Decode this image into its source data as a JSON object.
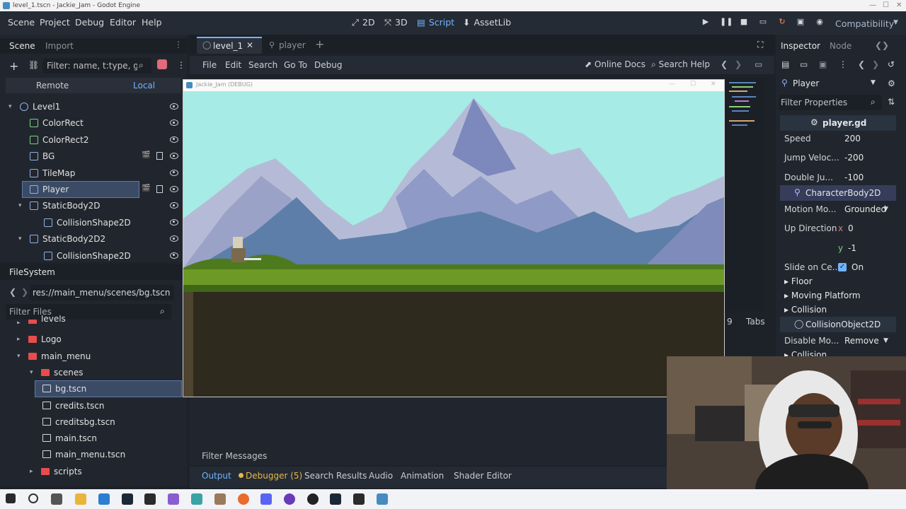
{
  "window": {
    "title": "level_1.tscn - Jackie_Jam - Godot Engine",
    "controls": [
      "—",
      "☐",
      "✕"
    ]
  },
  "menu": {
    "items": [
      "Scene",
      "Project",
      "Debug",
      "Editor",
      "Help"
    ]
  },
  "workspaces": [
    {
      "label": "2D",
      "icon": "2d-icon"
    },
    {
      "label": "3D",
      "icon": "3d-icon"
    },
    {
      "label": "Script",
      "icon": "script-icon"
    },
    {
      "label": "AssetLib",
      "icon": "assetlib-icon"
    }
  ],
  "renderer": "Compatibility",
  "scene_panel": {
    "tab_scene": "Scene",
    "tab_import": "Import",
    "filter_placeholder": "Filter: name, t:type, g:group",
    "remote": "Remote",
    "local": "Local",
    "nodes": [
      {
        "label": "Level1",
        "depth": 0
      },
      {
        "label": "ColorRect",
        "depth": 1
      },
      {
        "label": "ColorRect2",
        "depth": 1
      },
      {
        "label": "BG",
        "depth": 1
      },
      {
        "label": "TileMap",
        "depth": 1
      },
      {
        "label": "Player",
        "depth": 1
      },
      {
        "label": "StaticBody2D",
        "depth": 1
      },
      {
        "label": "CollisionShape2D",
        "depth": 2
      },
      {
        "label": "StaticBody2D2",
        "depth": 1
      },
      {
        "label": "CollisionShape2D",
        "depth": 2
      }
    ]
  },
  "filesystem": {
    "title": "FileSystem",
    "path": "res://main_menu/scenes/bg.tscn",
    "filter_placeholder": "Filter Files",
    "items": [
      {
        "label": "levels",
        "type": "folder",
        "depth": 1
      },
      {
        "label": "Logo",
        "type": "folder",
        "depth": 1
      },
      {
        "label": "main_menu",
        "type": "folder",
        "depth": 1
      },
      {
        "label": "scenes",
        "type": "folder",
        "depth": 2
      },
      {
        "label": "bg.tscn",
        "type": "file",
        "depth": 3
      },
      {
        "label": "credits.tscn",
        "type": "file",
        "depth": 3
      },
      {
        "label": "creditsbg.tscn",
        "type": "file",
        "depth": 3
      },
      {
        "label": "main.tscn",
        "type": "file",
        "depth": 3
      },
      {
        "label": "main_menu.tscn",
        "type": "file",
        "depth": 3
      },
      {
        "label": "scripts",
        "type": "folder",
        "depth": 2
      }
    ]
  },
  "editor_tabs": {
    "tab1": "level_1",
    "tab2": "player"
  },
  "script_menu": {
    "file": "File",
    "edit": "Edit",
    "search": "Search",
    "goto": "Go To",
    "debug": "Debug",
    "online_docs": "Online Docs",
    "search_help": "Search Help"
  },
  "game_window": {
    "title": "Jackie_Jam (DEBUG)"
  },
  "script_status": {
    "line": "9",
    "indent": "Tabs"
  },
  "bottom": {
    "filter_messages": "Filter Messages",
    "tabs": [
      "Output",
      "Debugger (5)",
      "Search Results",
      "Audio",
      "Animation",
      "Shader Editor"
    ]
  },
  "inspector": {
    "tab_inspector": "Inspector",
    "tab_node": "Node",
    "node": "Player",
    "filter": "Filter Properties",
    "script": "player.gd",
    "props": [
      {
        "k": "Speed",
        "v": "200"
      },
      {
        "k": "Jump Veloc...",
        "v": "-200"
      },
      {
        "k": "Double Ju...",
        "v": "-100"
      }
    ],
    "class": "CharacterBody2D",
    "motion_mode_k": "Motion Mo...",
    "motion_mode_v": "Grounded",
    "up_dir_k": "Up Direction",
    "up_x": "x",
    "up_x_v": "0",
    "up_y": "y",
    "up_y_v": "-1",
    "slide_k": "Slide on Ce...",
    "slide_v": "On",
    "sections": [
      "Floor",
      "Moving Platform",
      "Collision"
    ],
    "collision_object": "CollisionObject2D",
    "disable_k": "Disable Mo...",
    "disable_v": "Remove",
    "collision2": "Collision"
  },
  "colors": {
    "sky": "#a6ebe5",
    "accent": "#6fb4ff",
    "selection": "#3b4b66"
  }
}
